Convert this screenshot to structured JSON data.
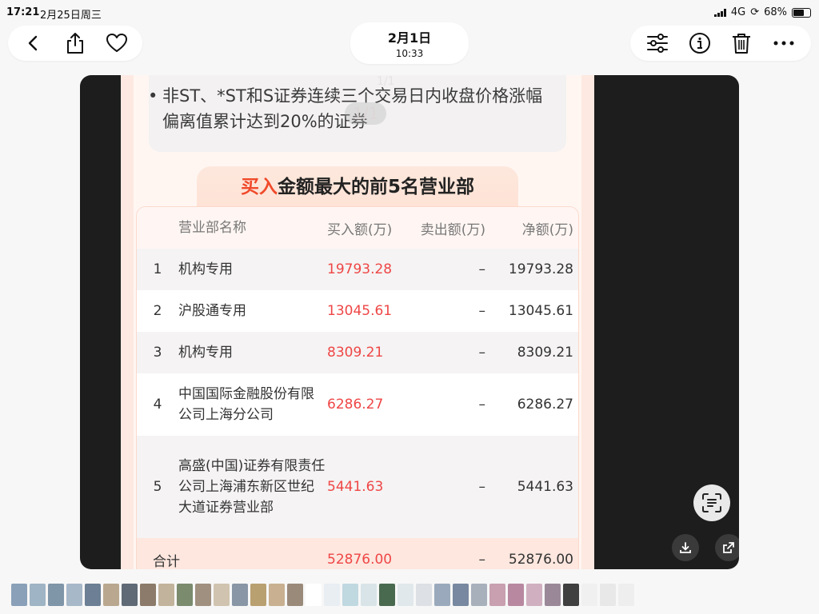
{
  "status_bar": {
    "time": "17:21",
    "date": "2月25日周三",
    "network": "4G",
    "battery": "68%",
    "battery_level": 0.68
  },
  "header": {
    "photo_date": "2月1日",
    "photo_time": "10:33"
  },
  "toolbar_left": {
    "icons": [
      "back-icon",
      "share-icon",
      "heart-icon"
    ]
  },
  "toolbar_right": {
    "icons": [
      "adjust-icon",
      "info-icon",
      "trash-icon",
      "more-icon"
    ]
  },
  "photo": {
    "overlay_small": "1/1",
    "overlay_big": "1/1",
    "note_bullet": "•",
    "note_text": "非ST、*ST和S证券连续三个交易日内收盘价格涨幅偏离值累计达到20%的证券",
    "title_accent": "买入",
    "title_rest": "金额最大的前5名营业部",
    "table": {
      "headers": {
        "name": "营业部名称",
        "buy": "买入额(万)",
        "sell": "卖出额(万)",
        "net": "净额(万)"
      },
      "rows": [
        {
          "rank": "1",
          "name": "机构专用",
          "buy": "19793.28",
          "sell": "–",
          "net": "19793.28"
        },
        {
          "rank": "2",
          "name": "沪股通专用",
          "buy": "13045.61",
          "sell": "–",
          "net": "13045.61"
        },
        {
          "rank": "3",
          "name": "机构专用",
          "buy": "8309.21",
          "sell": "–",
          "net": "8309.21"
        },
        {
          "rank": "4",
          "name": "中国国际金融股份有限公司上海分公司",
          "buy": "6286.27",
          "sell": "–",
          "net": "6286.27"
        },
        {
          "rank": "5",
          "name": "高盛(中国)证券有限责任公司上海浦东新区世纪大道证券营业部",
          "buy": "5441.63",
          "sell": "–",
          "net": "5441.63"
        }
      ],
      "total": {
        "label": "合计",
        "buy": "52876.00",
        "sell": "–",
        "net": "52876.00"
      }
    }
  },
  "viewer_buttons": [
    "live-text-icon",
    "download-icon",
    "open-external-icon"
  ],
  "colors": {
    "accent_red": "#f04a2b",
    "value_red": "#ef4646"
  }
}
